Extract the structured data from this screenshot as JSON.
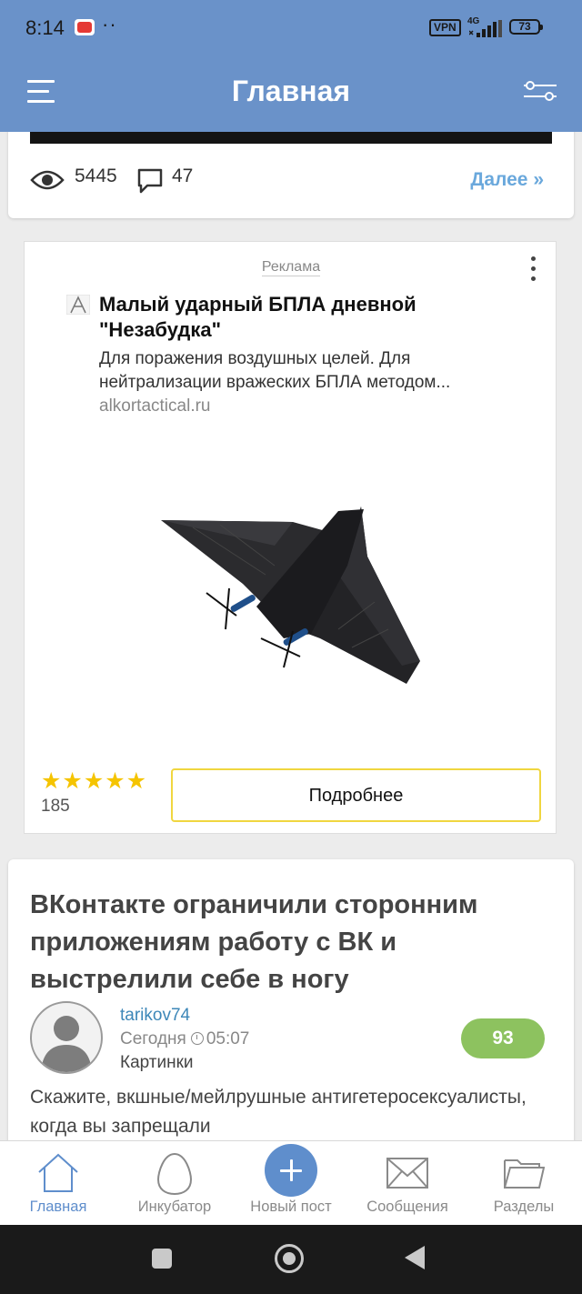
{
  "status_bar": {
    "time": "8:14",
    "vpn": "VPN",
    "network": "4G",
    "battery": "73"
  },
  "header": {
    "title": "Главная"
  },
  "top_post": {
    "views": "5445",
    "comments": "47",
    "more_label": "Далее »"
  },
  "ad": {
    "label": "Реклама",
    "title": "Малый ударный БПЛА дневной \"Незабудка\"",
    "description": "Для поражения воздушных целей. Для нейтрализации вражеских БПЛА методом...",
    "domain": "alkortactical.ru",
    "rating_stars": 5,
    "rating_count": "185",
    "button_label": "Подробнее"
  },
  "post": {
    "title": "ВКонтакте ограничили сторонним приложениям работу с ВК и выстрелили себе в ногу",
    "author": "tarikov74",
    "date": "Сегодня",
    "time": "05:07",
    "category": "Картинки",
    "score": "93",
    "text": "Скажите, вкшные/мейлрушные антигетеросексуалисты, когда вы запрещали"
  },
  "tabs": [
    {
      "label": "Главная",
      "icon": "home-icon",
      "active": true
    },
    {
      "label": "Инкубатор",
      "icon": "egg-icon",
      "active": false
    },
    {
      "label": "Новый пост",
      "icon": "plus-icon",
      "active": false
    },
    {
      "label": "Сообщения",
      "icon": "envelope-icon",
      "active": false
    },
    {
      "label": "Разделы",
      "icon": "folder-icon",
      "active": false
    }
  ],
  "colors": {
    "header_bg": "#6a92c9",
    "accent": "#5f8ecc",
    "link": "#6aa8dc",
    "score_bg": "#8dc25f",
    "star": "#f5c400"
  }
}
